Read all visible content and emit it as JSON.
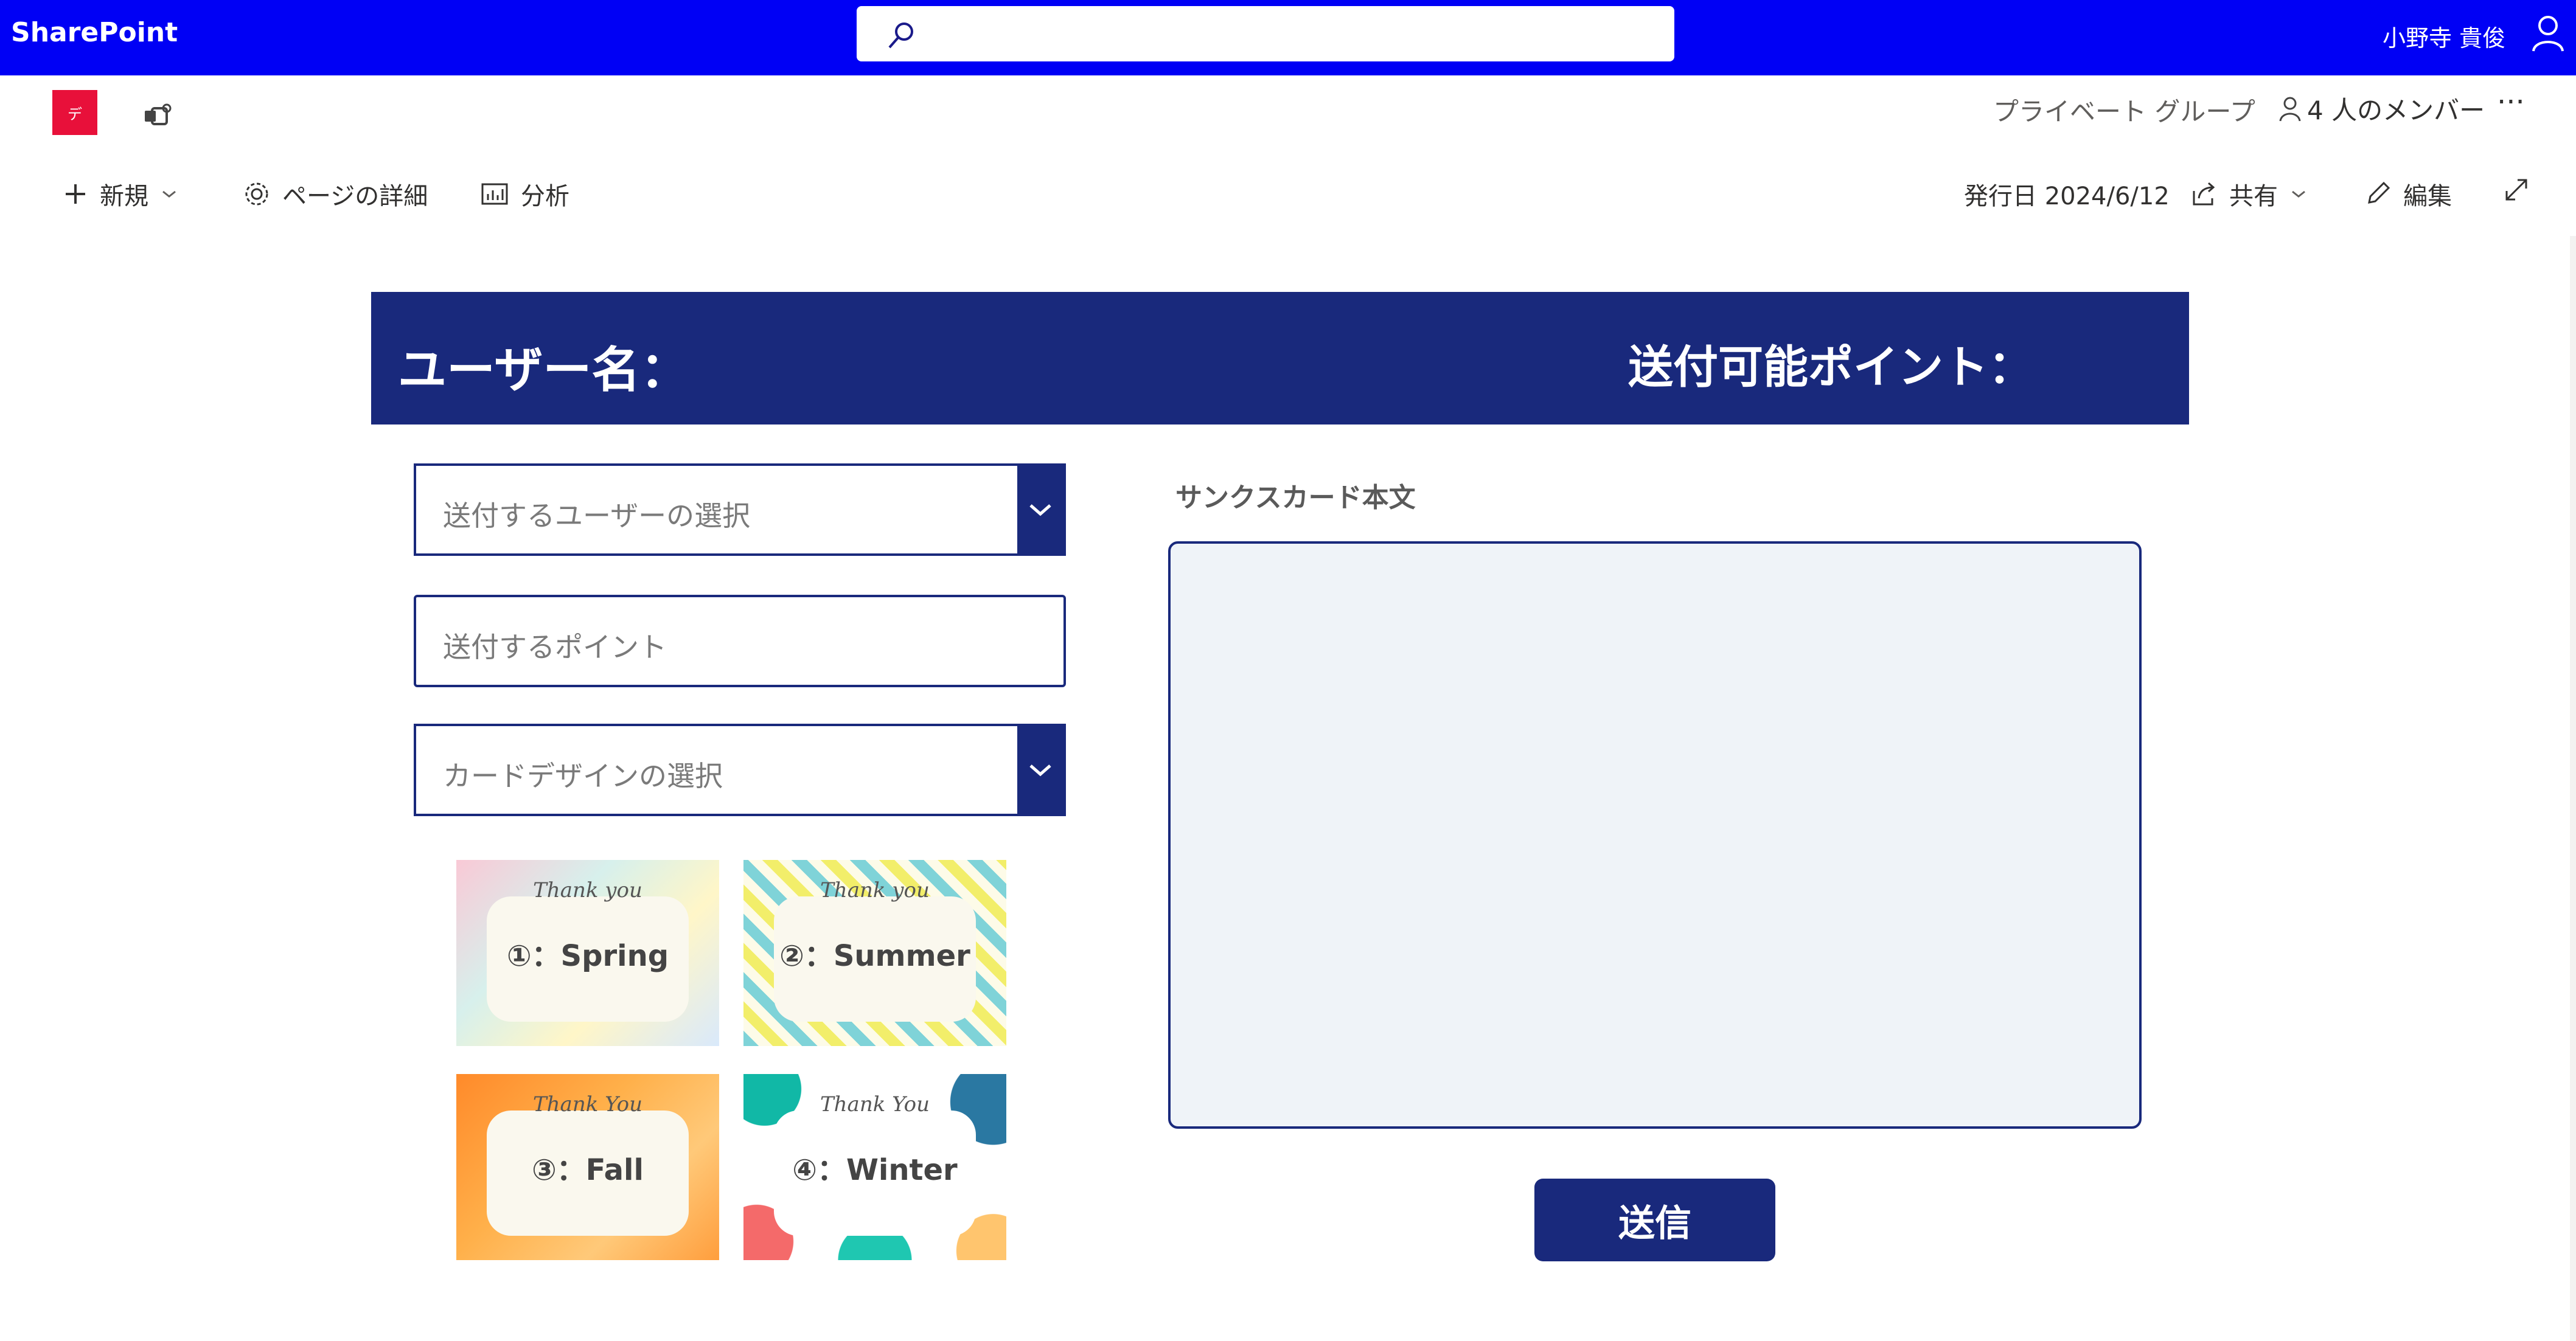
{
  "suite": {
    "brand": "SharePoint",
    "user": "小野寺 貴俊"
  },
  "site": {
    "logo_letter": "デ",
    "privacy": "プライベート グループ",
    "members": "4 人のメンバー",
    "more": "···"
  },
  "commandbar": {
    "new_label": "新規",
    "page_details_label": "ページの詳細",
    "analytics_label": "分析",
    "published": "発行日 2024/6/12",
    "share_label": "共有",
    "edit_label": "編集"
  },
  "app": {
    "username_label": "ユーザー名：",
    "points_label": "送付可能ポイント：",
    "select_user_placeholder": "送付するユーザーの選択",
    "points_placeholder": "送付するポイント",
    "card_design_placeholder": "カードデザインの選択",
    "message_label": "サンクスカード本文",
    "send_label": "送信",
    "cards": [
      {
        "caption": "①：Spring",
        "thank": "Thank you"
      },
      {
        "caption": "②：Summer",
        "thank": "Thank you"
      },
      {
        "caption": "③：Fall",
        "thank": "Thank You"
      },
      {
        "caption": "④：Winter",
        "thank": "Thank You"
      }
    ]
  },
  "colors": {
    "suite_bar": "#0000f5",
    "accent_navy": "#19297c",
    "site_logo": "#e8103a",
    "message_bg": "#eff3f8"
  }
}
